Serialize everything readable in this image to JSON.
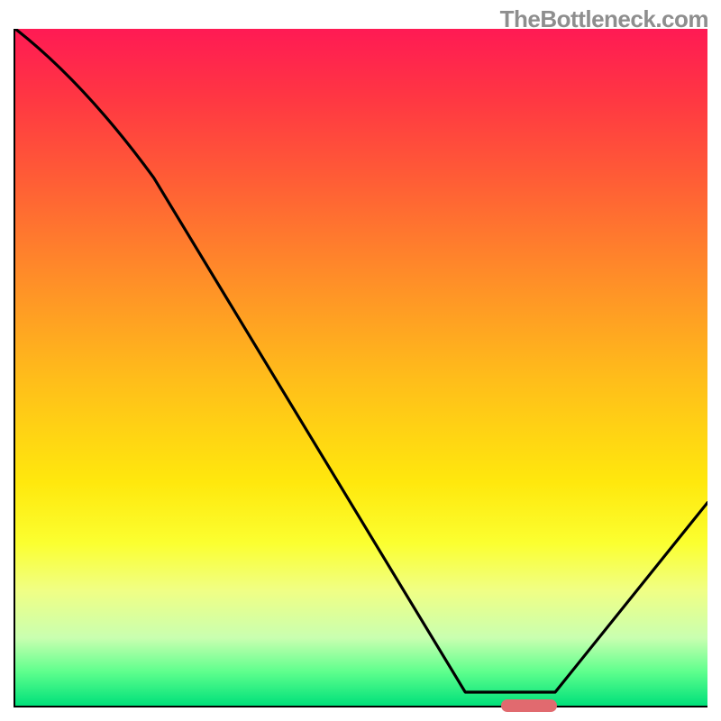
{
  "watermark": "TheBottleneck.com",
  "chart_data": {
    "type": "line",
    "title": "",
    "xlabel": "",
    "ylabel": "",
    "xlim": [
      0,
      100
    ],
    "ylim": [
      0,
      100
    ],
    "grid": false,
    "legend": false,
    "x": [
      0,
      20,
      65,
      72,
      78,
      100
    ],
    "values": [
      100,
      78,
      2,
      2,
      2,
      30
    ],
    "marker": {
      "x_start": 70,
      "x_end": 78,
      "y": 0
    },
    "colors": {
      "line": "#000000",
      "marker": "#e16a6f",
      "gradient_top": "#ff1a54",
      "gradient_bottom": "#00e07a"
    }
  }
}
